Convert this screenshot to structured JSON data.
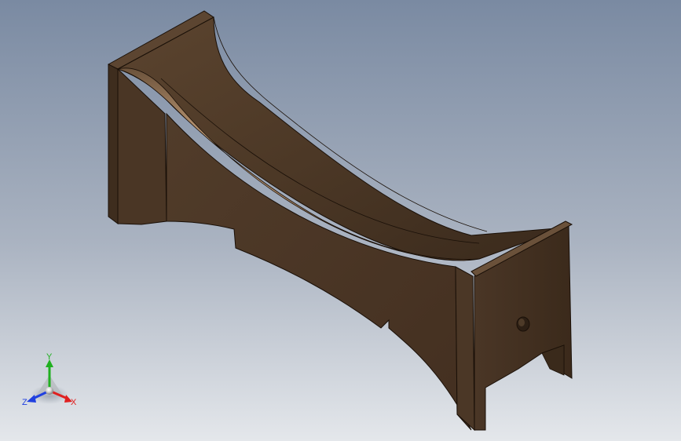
{
  "viewport": {
    "background_top": "#7c8ca4",
    "background_bottom": "#e3e6ea"
  },
  "model": {
    "name_icon": "3d-part-model",
    "color": "#5a4330",
    "highlight": "#c8a27a",
    "edge": "#1a1008"
  },
  "triad": {
    "x_label": "X",
    "y_label": "Y",
    "z_label": "Z",
    "x_color": "#e02020",
    "y_color": "#20b020",
    "z_color": "#2040e0"
  }
}
